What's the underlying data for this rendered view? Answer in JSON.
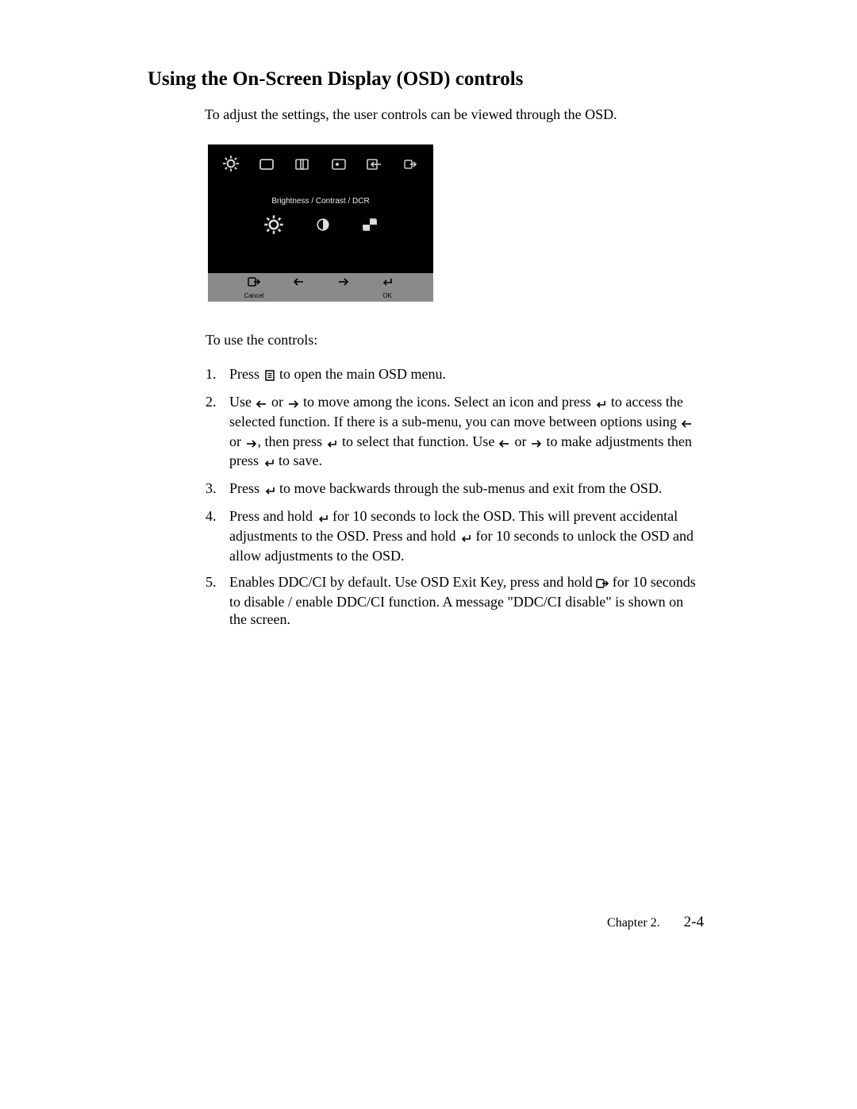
{
  "heading": "Using the On-Screen Display (OSD) controls",
  "intro": "To adjust the settings, the user controls can be viewed through the OSD.",
  "osd": {
    "top_icons": [
      "brightness-icon",
      "screen-icon",
      "position-icon",
      "image-icon",
      "input-icon",
      "exit-icon"
    ],
    "middle_title": "Brightness / Contrast / DCR",
    "sub_icons": [
      "brightness-icon",
      "contrast-icon",
      "dcr-icon"
    ],
    "footer_icons": [
      "exit-icon",
      "left-arrow-icon",
      "right-arrow-icon",
      "enter-icon"
    ],
    "footer_labels": [
      "Cancel",
      "",
      "",
      "OK"
    ]
  },
  "subhead": "To use the controls:",
  "steps": {
    "n1": "1.",
    "s1a": "Press ",
    "s1b": " to open the main OSD menu.",
    "n2": "2.",
    "s2a": "Use ",
    "s2b": " or ",
    "s2c": " to move among the icons. Select an icon and press ",
    "s2d": " to access the selected function. If there is a sub-menu, you can move between options using ",
    "s2e": " or ",
    "s2f": ",   then press ",
    "s2g": " to select that function. Use ",
    "s2h": " or ",
    "s2i": " to make adjustments then press ",
    "s2j": " to save.",
    "n3": "3.",
    "s3a": "Press ",
    "s3b": " to move backwards through the sub-menus and exit from the OSD.",
    "n4": "4.",
    "s4a": "Press and hold ",
    "s4b": " for 10 seconds to lock the OSD. This will prevent accidental adjustments to the OSD. Press and hold ",
    "s4c": " for 10 seconds to unlock the OSD and allow adjustments to the OSD.",
    "n5": "5.",
    "s5a": "Enables DDC/CI by default. Use OSD Exit Key, press and hold ",
    "s5b": " for 10 seconds to disable / enable DDC/CI function. A message \"DDC/CI disable\" is shown on the screen."
  },
  "footer": {
    "chapter": "Chapter 2.",
    "page": "2-4"
  }
}
